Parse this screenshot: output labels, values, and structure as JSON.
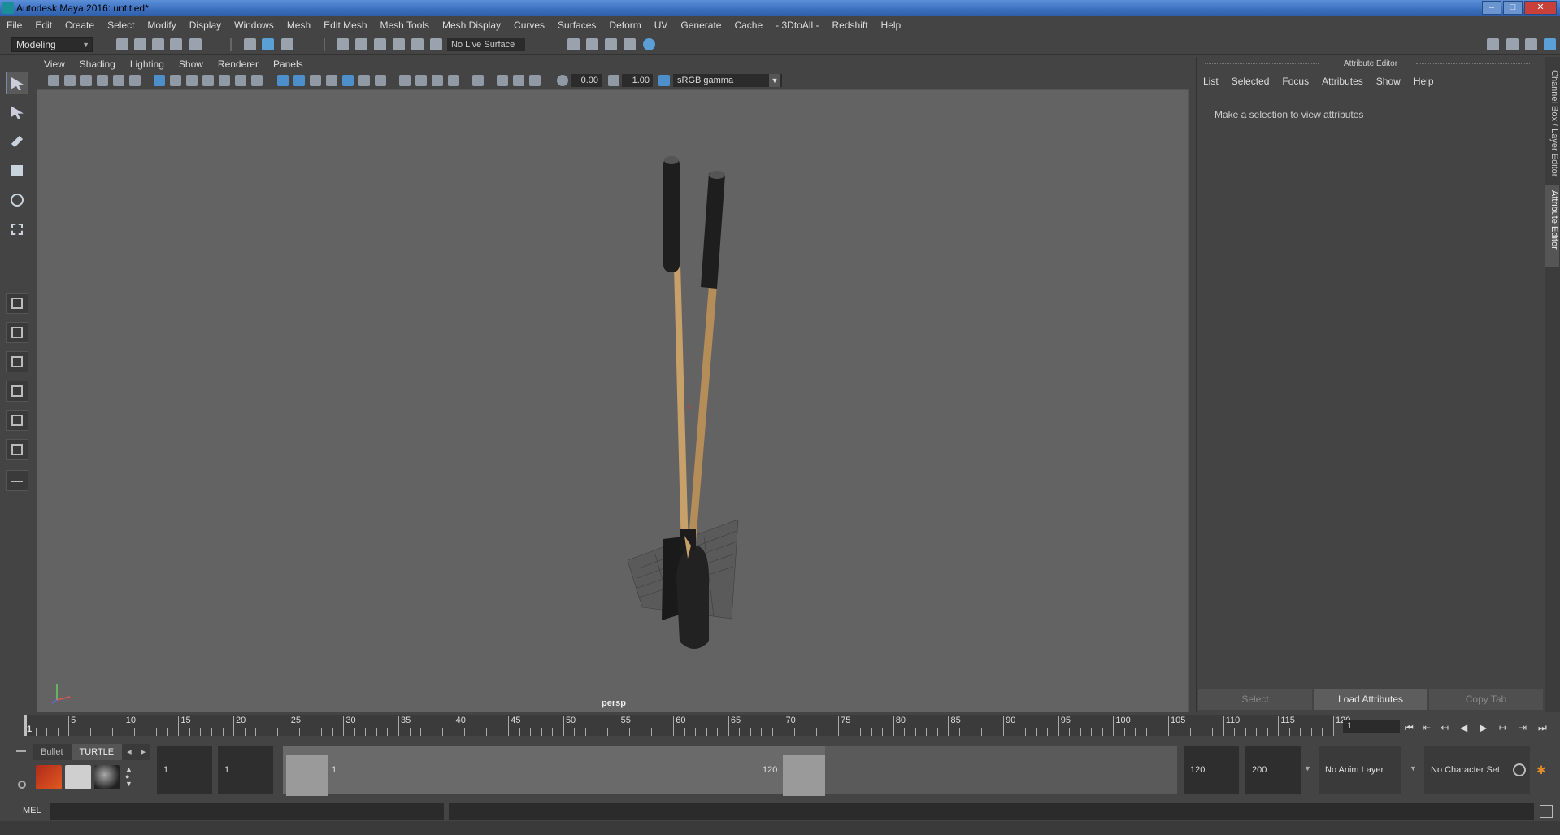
{
  "window": {
    "title": "Autodesk Maya 2016: untitled*"
  },
  "menubar": [
    "File",
    "Edit",
    "Create",
    "Select",
    "Modify",
    "Display",
    "Windows",
    "Mesh",
    "Edit Mesh",
    "Mesh Tools",
    "Mesh Display",
    "Curves",
    "Surfaces",
    "Deform",
    "UV",
    "Generate",
    "Cache",
    "- 3DtoAll -",
    "Redshift",
    "Help"
  ],
  "status_line": {
    "mode": "Modeling",
    "live_surface": "No Live Surface"
  },
  "viewport": {
    "menu": [
      "View",
      "Shading",
      "Lighting",
      "Show",
      "Renderer",
      "Panels"
    ],
    "exposure": "0.00",
    "gamma_value": "1.00",
    "color_space": "sRGB gamma",
    "camera_label": "persp"
  },
  "attribute_editor": {
    "title": "Attribute Editor",
    "menu": [
      "List",
      "Selected",
      "Focus",
      "Attributes",
      "Show",
      "Help"
    ],
    "hint": "Make a selection to view attributes",
    "buttons": {
      "select": "Select",
      "load": "Load Attributes",
      "copy": "Copy Tab"
    }
  },
  "side_tabs": {
    "channel_box": "Channel Box / Layer Editor",
    "attribute_editor": "Attribute Editor"
  },
  "timeline": {
    "labels": [
      "1",
      "5",
      "10",
      "15",
      "20",
      "25",
      "30",
      "35",
      "40",
      "45",
      "50",
      "55",
      "60",
      "65",
      "70",
      "75",
      "80",
      "85",
      "90",
      "95",
      "100",
      "105",
      "110",
      "115",
      "120"
    ],
    "current_frame": "1"
  },
  "range": {
    "shelf_tabs": [
      "Bullet",
      "TURTLE"
    ],
    "start": "1",
    "playback_start": "1",
    "slider_start": "1",
    "slider_end": "120",
    "playback_end": "120",
    "end": "200",
    "anim_layer": "No Anim Layer",
    "character_set": "No Character Set"
  },
  "command_line": {
    "label": "MEL"
  },
  "colors": {
    "viewport_bg": "#636363",
    "panel_bg": "#444444",
    "accent": "#5a9fd6",
    "handle_wood": "#c8a06a",
    "grip_black": "#1e1e1e"
  }
}
